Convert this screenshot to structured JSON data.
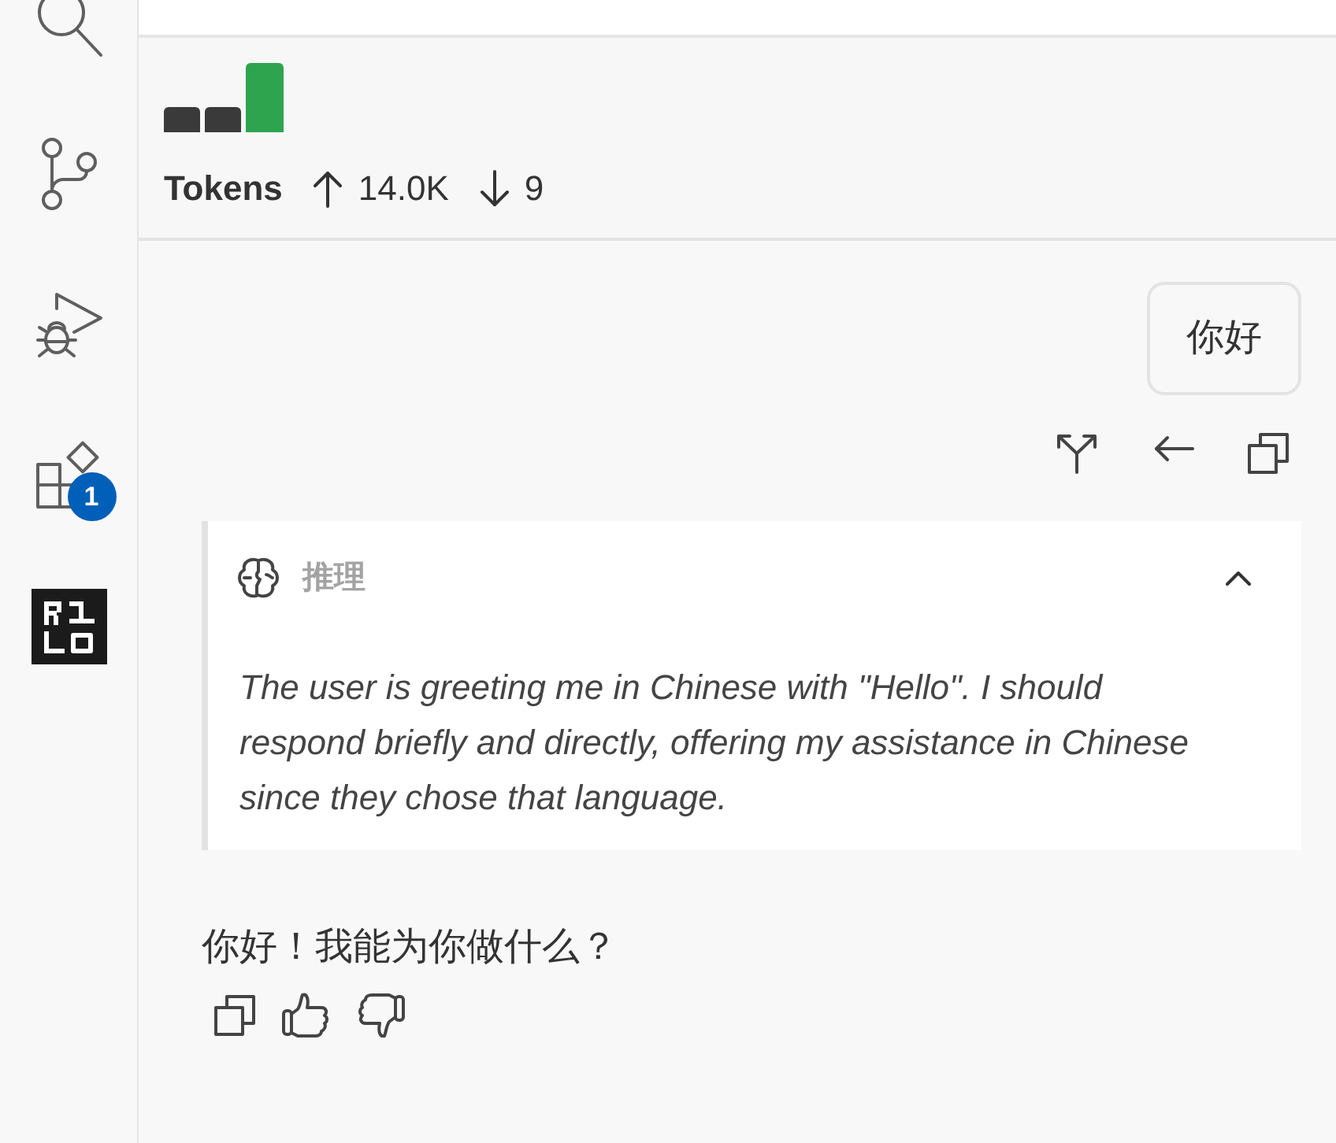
{
  "activity_bar": {
    "items": [
      {
        "kind": "search"
      },
      {
        "kind": "source-control"
      },
      {
        "kind": "run-debug"
      },
      {
        "kind": "extensions",
        "badge": "1"
      },
      {
        "kind": "logo"
      }
    ]
  },
  "token_usage": {
    "label": "Tokens",
    "input": "14.0K",
    "output": "9"
  },
  "messages": [
    {
      "kind": "user",
      "text": "你好"
    },
    {
      "kind": "reasoning",
      "title": "推理",
      "expanded": true,
      "text": "The user is greeting me in Chinese with \"Hello\". I should respond briefly and directly, offering my assistance in Chinese since they chose that language."
    },
    {
      "kind": "assistant",
      "text": "你好！我能为你做什么？"
    }
  ]
}
